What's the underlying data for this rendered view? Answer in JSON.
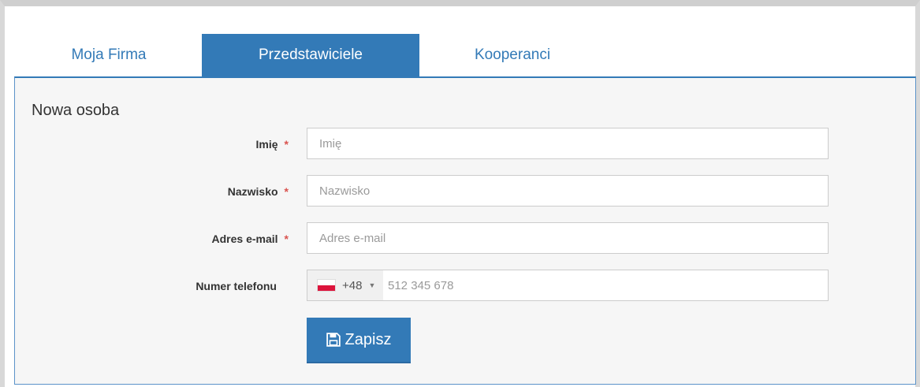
{
  "tabs": [
    {
      "label": "Moja Firma"
    },
    {
      "label": "Przedstawiciele"
    },
    {
      "label": "Kooperanci"
    }
  ],
  "form": {
    "title": "Nowa osoba",
    "required_marker": "*",
    "first_name": {
      "label": "Imię",
      "placeholder": "Imię"
    },
    "last_name": {
      "label": "Nazwisko",
      "placeholder": "Nazwisko"
    },
    "email": {
      "label": "Adres e-mail",
      "placeholder": "Adres e-mail"
    },
    "phone": {
      "label": "Numer telefonu",
      "country_code": "+48",
      "placeholder": "512 345 678",
      "flag": "poland-flag-icon"
    },
    "save_label": "Zapisz"
  },
  "colors": {
    "accent": "#337ab7",
    "required": "#d9534f",
    "panel_bg": "#f6f6f6"
  }
}
